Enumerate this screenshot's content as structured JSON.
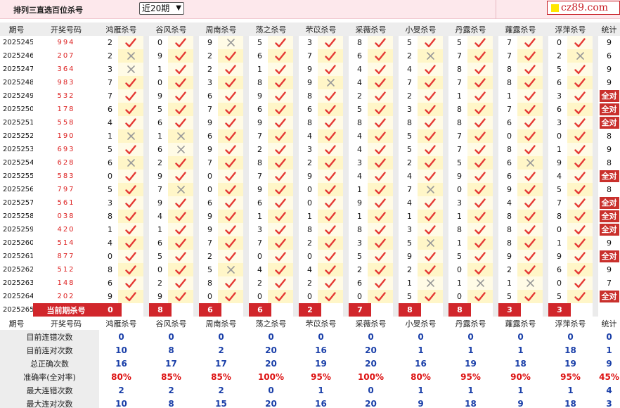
{
  "header": {
    "title": "排列三直选百位杀号",
    "period_select": "近20期",
    "logo_text": "cz89.com"
  },
  "columns": {
    "period": "期号",
    "draw": "开奖号码",
    "experts": [
      "鸿雁杀号",
      "谷风杀号",
      "周南杀号",
      "荡之杀号",
      "芣苡杀号",
      "采薇杀号",
      "小旻杀号",
      "丹露杀号",
      "蕹露杀号",
      "浮萍杀号"
    ],
    "stats": "统计"
  },
  "rows": [
    {
      "period": "2025245",
      "draw": "994",
      "kills": [
        2,
        0,
        9,
        5,
        3,
        8,
        5,
        5,
        7,
        0
      ],
      "marks": [
        "ok",
        "ok",
        "no",
        "ok",
        "ok",
        "ok",
        "ok",
        "ok",
        "ok",
        "ok"
      ],
      "stat": "9"
    },
    {
      "period": "2025246",
      "draw": "207",
      "kills": [
        2,
        9,
        2,
        6,
        7,
        6,
        2,
        7,
        7,
        2
      ],
      "marks": [
        "no",
        "ok",
        "ok",
        "ok",
        "ok",
        "ok",
        "no",
        "ok",
        "ok",
        "no"
      ],
      "stat": "6"
    },
    {
      "period": "2025247",
      "draw": "364",
      "kills": [
        3,
        1,
        2,
        1,
        9,
        4,
        4,
        8,
        8,
        5
      ],
      "marks": [
        "no",
        "ok",
        "ok",
        "ok",
        "ok",
        "ok",
        "ok",
        "ok",
        "ok",
        "ok"
      ],
      "stat": "9"
    },
    {
      "period": "2025248",
      "draw": "983",
      "kills": [
        7,
        0,
        3,
        8,
        9,
        4,
        7,
        7,
        8,
        6
      ],
      "marks": [
        "ok",
        "ok",
        "ok",
        "ok",
        "no",
        "ok",
        "ok",
        "ok",
        "ok",
        "ok"
      ],
      "stat": "9"
    },
    {
      "period": "2025249",
      "draw": "532",
      "kills": [
        7,
        9,
        6,
        9,
        8,
        2,
        2,
        1,
        1,
        3
      ],
      "marks": [
        "ok",
        "ok",
        "ok",
        "ok",
        "ok",
        "ok",
        "ok",
        "ok",
        "ok",
        "ok"
      ],
      "stat": "全对"
    },
    {
      "period": "2025250",
      "draw": "178",
      "kills": [
        6,
        5,
        7,
        6,
        6,
        5,
        3,
        8,
        7,
        6
      ],
      "marks": [
        "ok",
        "ok",
        "ok",
        "ok",
        "ok",
        "ok",
        "ok",
        "ok",
        "ok",
        "ok"
      ],
      "stat": "全对"
    },
    {
      "period": "2025251",
      "draw": "558",
      "kills": [
        4,
        6,
        9,
        9,
        8,
        8,
        8,
        8,
        6,
        3
      ],
      "marks": [
        "ok",
        "ok",
        "ok",
        "ok",
        "ok",
        "ok",
        "ok",
        "ok",
        "ok",
        "ok"
      ],
      "stat": "全对"
    },
    {
      "period": "2025252",
      "draw": "190",
      "kills": [
        1,
        1,
        6,
        7,
        4,
        4,
        5,
        7,
        0,
        0
      ],
      "marks": [
        "no",
        "no",
        "ok",
        "ok",
        "ok",
        "ok",
        "ok",
        "ok",
        "ok",
        "ok"
      ],
      "stat": "8"
    },
    {
      "period": "2025253",
      "draw": "693",
      "kills": [
        5,
        6,
        9,
        2,
        3,
        4,
        5,
        7,
        8,
        1
      ],
      "marks": [
        "ok",
        "no",
        "ok",
        "ok",
        "ok",
        "ok",
        "ok",
        "ok",
        "ok",
        "ok"
      ],
      "stat": "9"
    },
    {
      "period": "2025254",
      "draw": "628",
      "kills": [
        6,
        2,
        7,
        8,
        2,
        3,
        2,
        5,
        6,
        9
      ],
      "marks": [
        "no",
        "ok",
        "ok",
        "ok",
        "ok",
        "ok",
        "ok",
        "ok",
        "no",
        "ok"
      ],
      "stat": "8"
    },
    {
      "period": "2025255",
      "draw": "583",
      "kills": [
        0,
        9,
        0,
        7,
        9,
        4,
        4,
        9,
        6,
        4
      ],
      "marks": [
        "ok",
        "ok",
        "ok",
        "ok",
        "ok",
        "ok",
        "ok",
        "ok",
        "ok",
        "ok"
      ],
      "stat": "全对"
    },
    {
      "period": "2025256",
      "draw": "797",
      "kills": [
        5,
        7,
        0,
        9,
        0,
        1,
        7,
        0,
        9,
        5
      ],
      "marks": [
        "ok",
        "no",
        "ok",
        "ok",
        "ok",
        "ok",
        "no",
        "ok",
        "ok",
        "ok"
      ],
      "stat": "8"
    },
    {
      "period": "2025257",
      "draw": "561",
      "kills": [
        3,
        9,
        6,
        6,
        0,
        9,
        4,
        3,
        4,
        7
      ],
      "marks": [
        "ok",
        "ok",
        "ok",
        "ok",
        "ok",
        "ok",
        "ok",
        "ok",
        "ok",
        "ok"
      ],
      "stat": "全对"
    },
    {
      "period": "2025258",
      "draw": "038",
      "kills": [
        8,
        4,
        9,
        1,
        1,
        1,
        1,
        1,
        8,
        8
      ],
      "marks": [
        "ok",
        "ok",
        "ok",
        "ok",
        "ok",
        "ok",
        "ok",
        "ok",
        "ok",
        "ok"
      ],
      "stat": "全对"
    },
    {
      "period": "2025259",
      "draw": "420",
      "kills": [
        1,
        1,
        9,
        3,
        8,
        8,
        3,
        8,
        8,
        0
      ],
      "marks": [
        "ok",
        "ok",
        "ok",
        "ok",
        "ok",
        "ok",
        "ok",
        "ok",
        "ok",
        "ok"
      ],
      "stat": "全对"
    },
    {
      "period": "2025260",
      "draw": "514",
      "kills": [
        4,
        6,
        7,
        7,
        2,
        3,
        5,
        1,
        8,
        1
      ],
      "marks": [
        "ok",
        "ok",
        "ok",
        "ok",
        "ok",
        "ok",
        "no",
        "ok",
        "ok",
        "ok"
      ],
      "stat": "9"
    },
    {
      "period": "2025261",
      "draw": "877",
      "kills": [
        0,
        5,
        2,
        0,
        0,
        5,
        9,
        5,
        9,
        9
      ],
      "marks": [
        "ok",
        "ok",
        "ok",
        "ok",
        "ok",
        "ok",
        "ok",
        "ok",
        "ok",
        "ok"
      ],
      "stat": "全对"
    },
    {
      "period": "2025262",
      "draw": "512",
      "kills": [
        8,
        0,
        5,
        4,
        4,
        2,
        2,
        0,
        2,
        6
      ],
      "marks": [
        "ok",
        "ok",
        "no",
        "ok",
        "ok",
        "ok",
        "ok",
        "ok",
        "ok",
        "ok"
      ],
      "stat": "9"
    },
    {
      "period": "2025263",
      "draw": "148",
      "kills": [
        6,
        2,
        8,
        2,
        2,
        6,
        1,
        1,
        1,
        0
      ],
      "marks": [
        "ok",
        "ok",
        "ok",
        "ok",
        "ok",
        "ok",
        "no",
        "no",
        "no",
        "ok"
      ],
      "stat": "7"
    },
    {
      "period": "2025264",
      "draw": "202",
      "kills": [
        9,
        9,
        0,
        0,
        0,
        0,
        5,
        0,
        5,
        5
      ],
      "marks": [
        "ok",
        "ok",
        "ok",
        "ok",
        "ok",
        "ok",
        "ok",
        "ok",
        "ok",
        "ok"
      ],
      "stat": "全对"
    }
  ],
  "current": {
    "period": "2025265",
    "label": "当前期杀号",
    "kills": [
      "0",
      "8",
      "6",
      "6",
      "2",
      "7",
      "8",
      "8",
      "3",
      "3"
    ]
  },
  "summary": [
    {
      "label": "目前连错次数",
      "values": [
        "0",
        "0",
        "0",
        "0",
        "0",
        "0",
        "0",
        "0",
        "0",
        "0",
        "0"
      ]
    },
    {
      "label": "目前连对次数",
      "values": [
        "10",
        "8",
        "2",
        "20",
        "16",
        "20",
        "1",
        "1",
        "1",
        "18",
        "1"
      ]
    },
    {
      "label": "总正确次数",
      "values": [
        "16",
        "17",
        "17",
        "20",
        "19",
        "20",
        "16",
        "19",
        "18",
        "19",
        "9"
      ]
    },
    {
      "label": "准确率(全对率)",
      "values": [
        "80%",
        "85%",
        "85%",
        "100%",
        "95%",
        "100%",
        "80%",
        "95%",
        "90%",
        "95%",
        "45%"
      ]
    },
    {
      "label": "最大连错次数",
      "values": [
        "2",
        "2",
        "2",
        "0",
        "1",
        "0",
        "1",
        "1",
        "1",
        "1",
        "4"
      ]
    },
    {
      "label": "最大连对次数",
      "values": [
        "10",
        "8",
        "15",
        "20",
        "16",
        "20",
        "9",
        "18",
        "9",
        "18",
        "3"
      ]
    }
  ],
  "colors": {
    "red": "#d1262b",
    "check": "#e53935",
    "cross": "#9a9a9a",
    "blue": "#1a3fa8"
  }
}
